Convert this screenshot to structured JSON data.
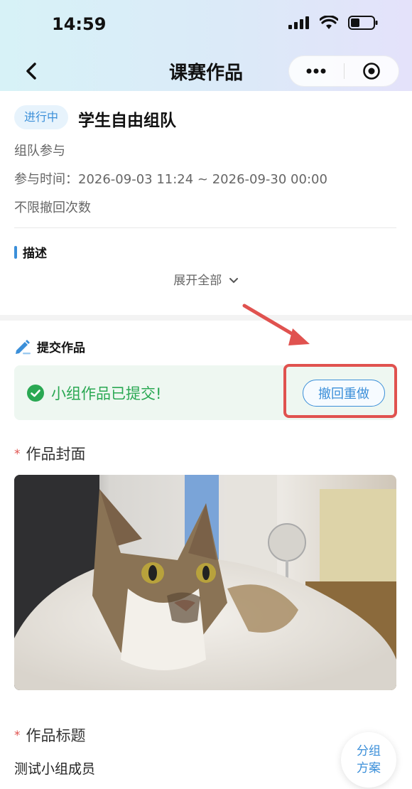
{
  "status_bar": {
    "time": "14:59"
  },
  "nav": {
    "title": "课赛作品"
  },
  "info": {
    "badge": "进行中",
    "team_title": "学生自由组队",
    "mode": "组队参与",
    "time_range": "参与时间：2026-09-03 11:24 ~ 2026-09-30 00:00",
    "withdraw_rule": "不限撤回次数",
    "description_label": "描述",
    "expand_label": "展开全部"
  },
  "submission": {
    "section_label": "提交作品",
    "status_text": "小组作品已提交!",
    "withdraw_button": "撤回重做"
  },
  "fields": {
    "cover_label": "作品封面",
    "title_label": "作品标题",
    "title_value": "测试小组成员"
  },
  "float_button": {
    "line1": "分组",
    "line2": "方案"
  },
  "colors": {
    "accent": "#3b8fd9",
    "success": "#2aa853",
    "highlight": "#e0524f"
  }
}
